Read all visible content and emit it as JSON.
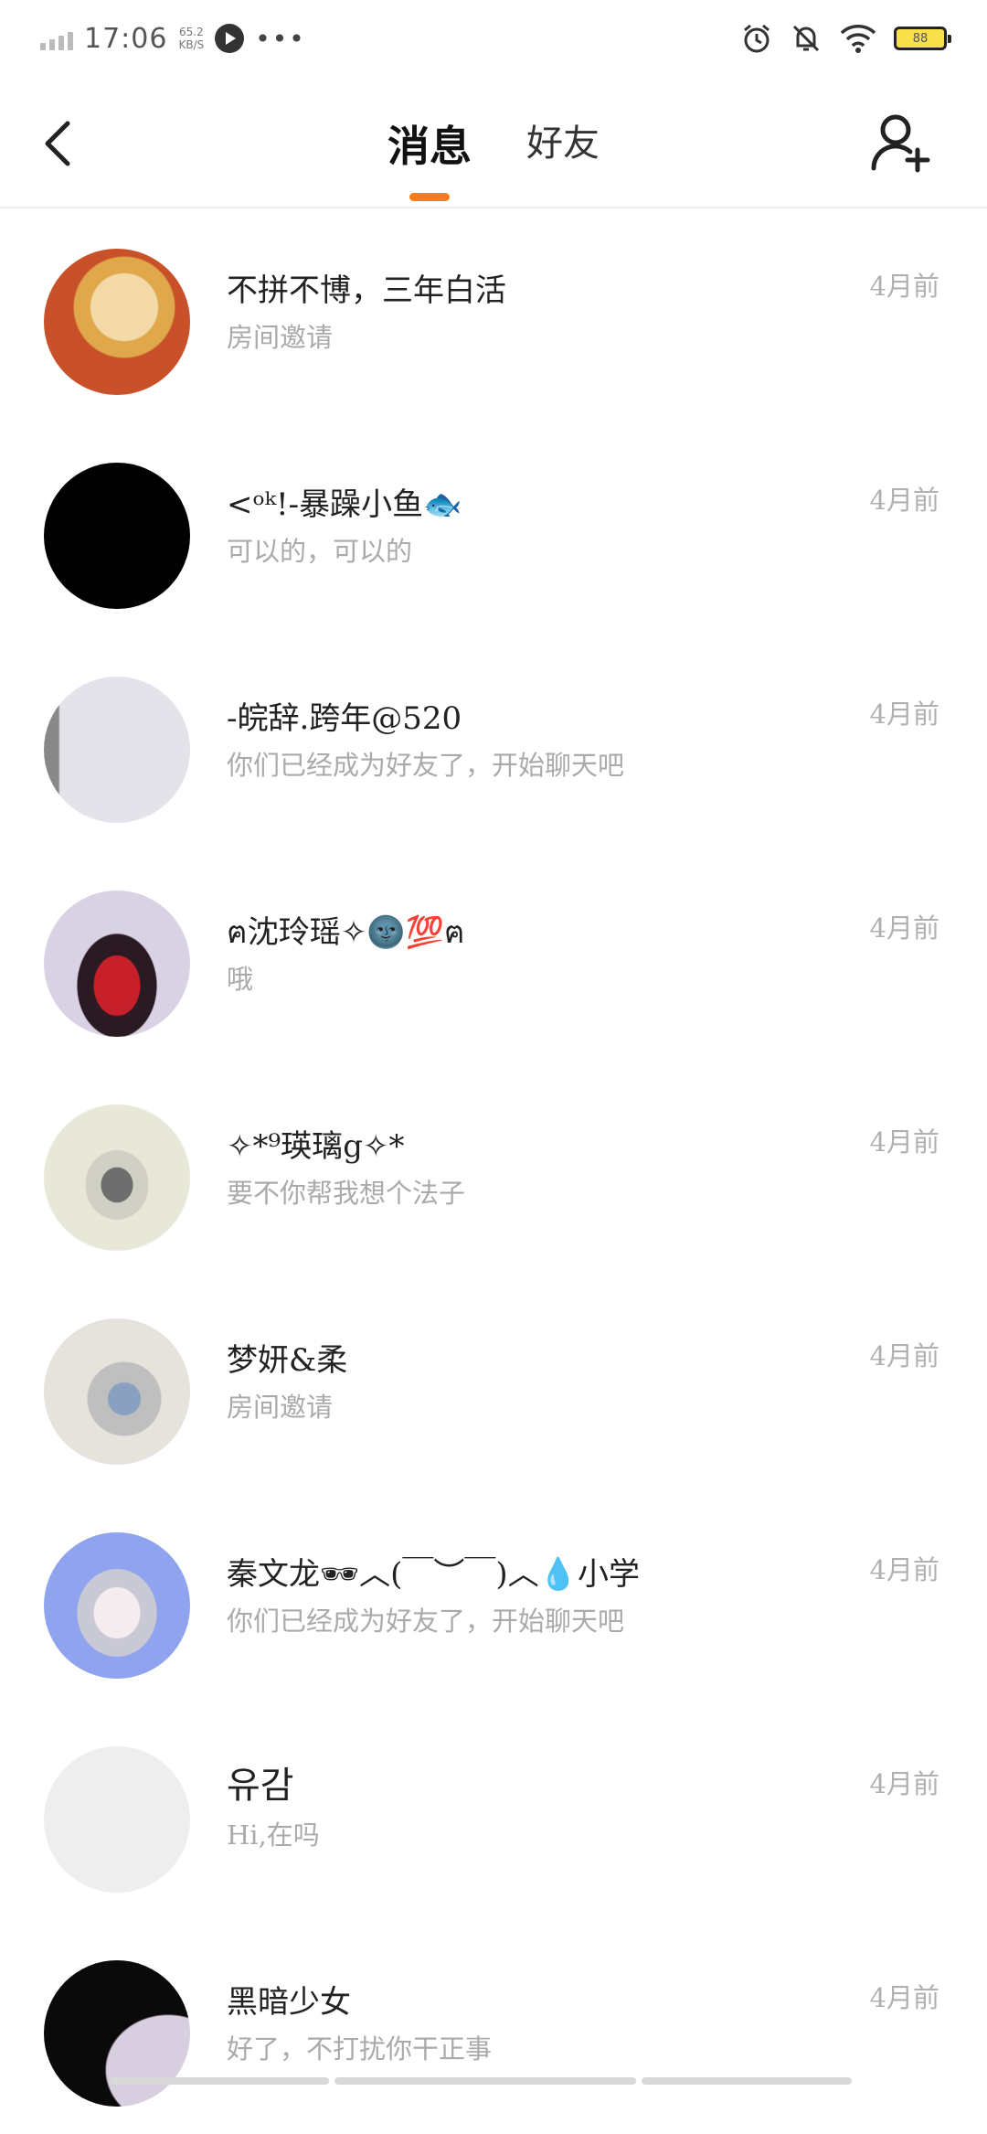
{
  "status_bar": {
    "time": "17:06",
    "speed_value": "65.2",
    "speed_unit": "KB/S",
    "battery": "88"
  },
  "header": {
    "tabs": [
      {
        "label": "消息",
        "active": true
      },
      {
        "label": "好友",
        "active": false
      }
    ]
  },
  "colors": {
    "accent": "#ff7a1a",
    "battery": "#f7e04a"
  },
  "messages": [
    {
      "name": "不拼不博，三年白活",
      "preview": "房间邀请",
      "time": "4月前",
      "avatar_color": "#c9512a"
    },
    {
      "name": "<ᵒᵏ!-暴躁小鱼🐟",
      "preview": "可以的，可以的",
      "time": "4月前",
      "avatar_color": "#000000"
    },
    {
      "name": "-皖辞.跨年@520",
      "preview": "你们已经成为好友了，开始聊天吧",
      "time": "4月前",
      "avatar_color": "#e4e3ea"
    },
    {
      "name": "ฅ沈玲瑶✧🌚💯ฅ",
      "preview": "哦",
      "time": "4月前",
      "avatar_color": "#d8d2e4"
    },
    {
      "name": "✧*⁹瑛璃ց✧*",
      "preview": "要不你帮我想个法子",
      "time": "4月前",
      "avatar_color": "#e8e8d8"
    },
    {
      "name": "梦妍&柔",
      "preview": "房间邀请",
      "time": "4月前",
      "avatar_color": "#e6e2dc"
    },
    {
      "name": "秦文龙🕶︿(￣︶￣)︿💧小学",
      "preview": "你们已经成为好友了，开始聊天吧",
      "time": "4月前",
      "avatar_color": "#8fa3ef"
    },
    {
      "name": "유감",
      "preview": "Hi,在吗",
      "time": "4月前",
      "avatar_color": "#eeeeee"
    },
    {
      "name": "黑暗少女",
      "preview": "好了，不打扰你干正事",
      "time": "4月前",
      "avatar_color": "#0a0a0a"
    }
  ]
}
